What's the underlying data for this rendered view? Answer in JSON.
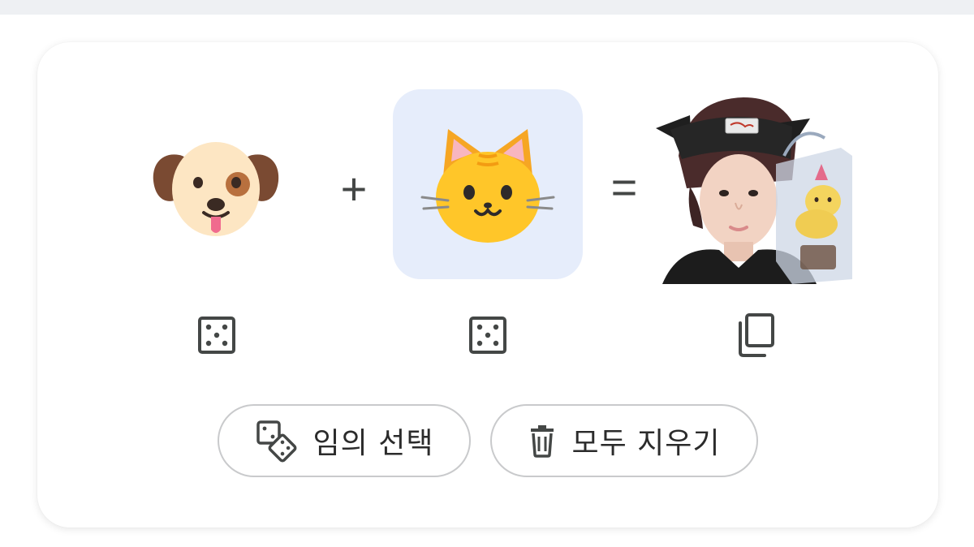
{
  "mixer": {
    "left_emoji": {
      "icon": "dog-face-icon"
    },
    "plus": "+",
    "right_emoji": {
      "icon": "cat-face-icon",
      "selected": true
    },
    "equals": "=",
    "result": {
      "icon": "result-photo"
    }
  },
  "controls": {
    "left_randomize_icon": "dice-icon",
    "right_randomize_icon": "dice-icon",
    "copy_icon": "copy-icon"
  },
  "buttons": {
    "random_label": "임의 선택",
    "clear_label": "모두 지우기"
  },
  "colors": {
    "selected_background": "#e6edfb",
    "icon_stroke": "#444746",
    "button_border": "#c9cacc"
  }
}
